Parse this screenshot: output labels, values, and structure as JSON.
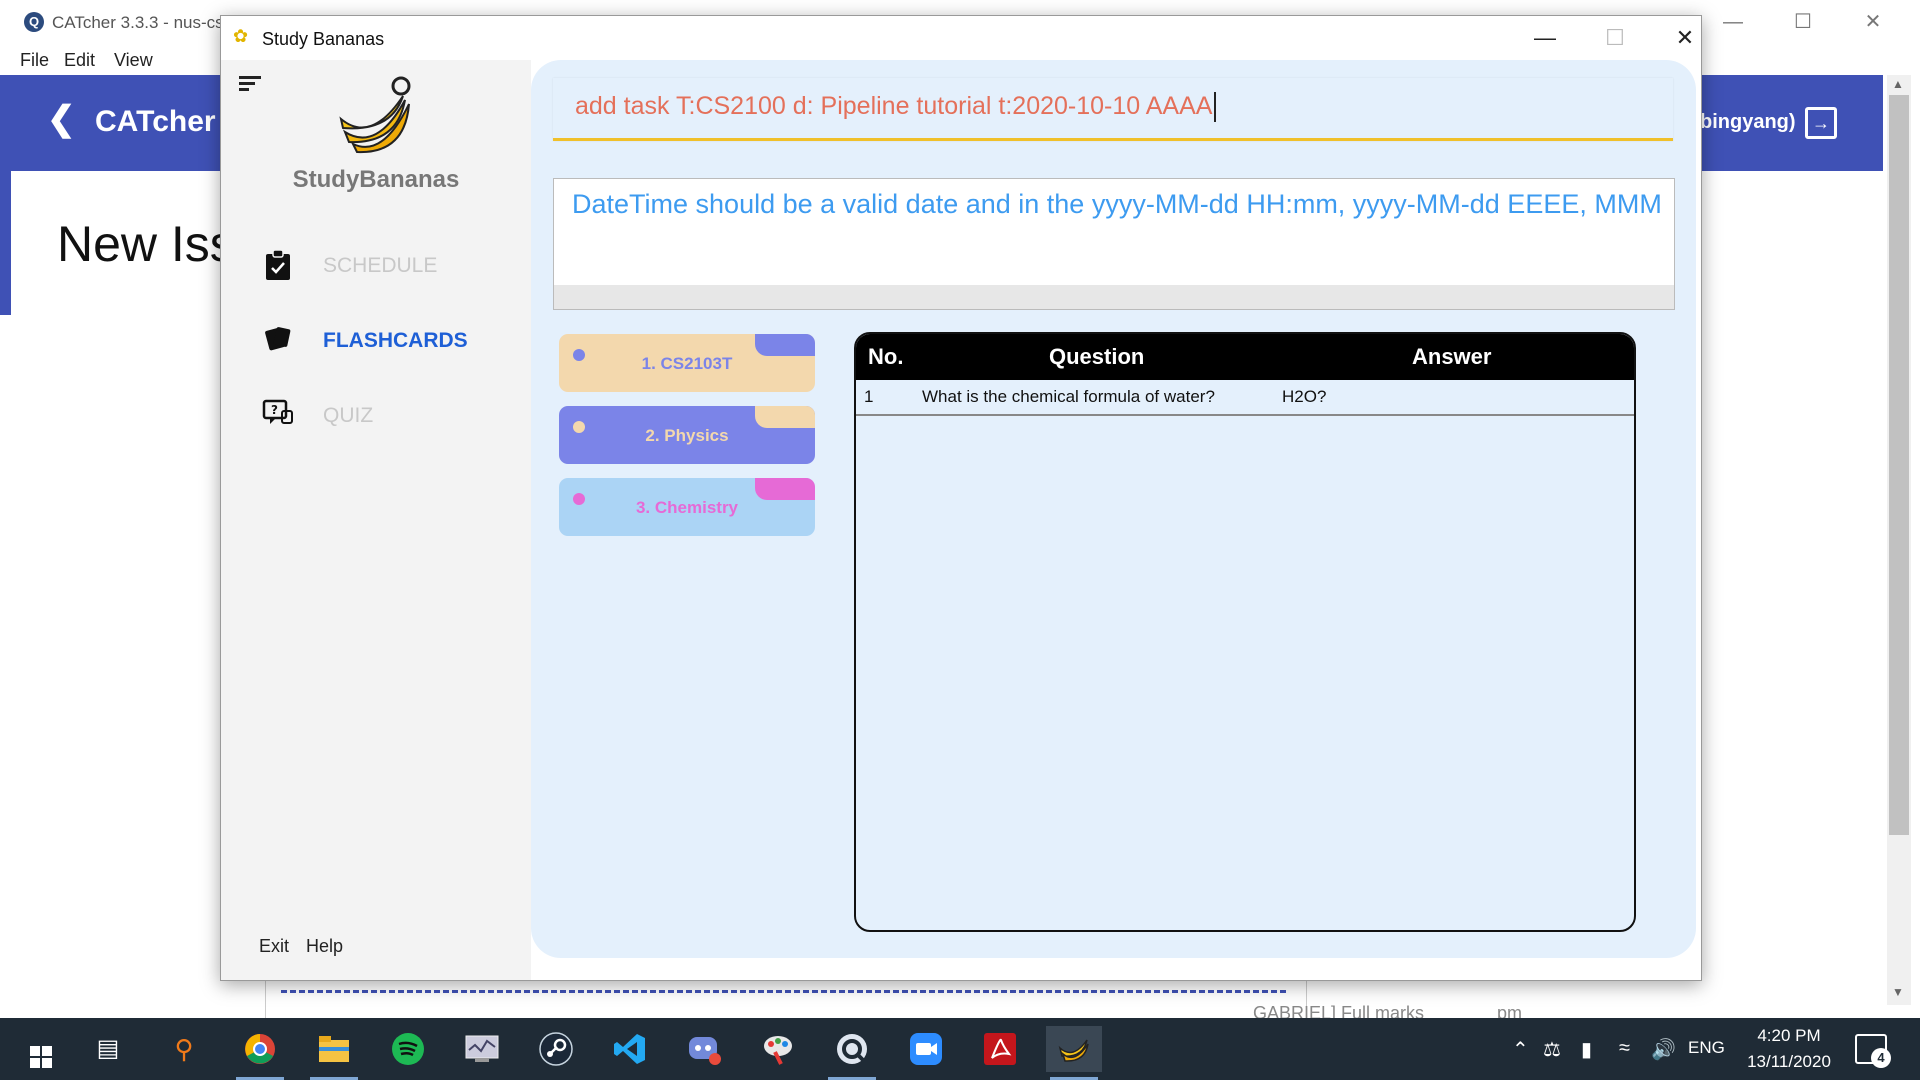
{
  "background_app": {
    "title": "CATcher 3.3.3 - nus-cs",
    "menu": [
      "File",
      "Edit",
      "View"
    ],
    "toolbar_title": "CATcher",
    "user": "bingyang)",
    "heading": "New Iss",
    "bottom_texts": [
      "GABRIEL] Full marks",
      "pm"
    ],
    "brand_color": "#3f51b5"
  },
  "window": {
    "title": "Study Bananas"
  },
  "sidebar": {
    "brand": "StudyBananas",
    "nav": [
      {
        "label": "SCHEDULE",
        "icon": "clipboard-check-icon",
        "active": false
      },
      {
        "label": "FLASHCARDS",
        "icon": "cards-icon",
        "active": true
      },
      {
        "label": "QUIZ",
        "icon": "quiz-icon",
        "active": false
      }
    ],
    "footer": {
      "exit": "Exit",
      "help": "Help"
    }
  },
  "command_box": {
    "value": "add task T:CS2100 d: Pipeline tutorial t:2020-10-10 AAAA"
  },
  "result_display": {
    "text": "DateTime should be a valid date and in the yyyy-MM-dd HH:mm, yyyy-MM-dd EEEE, MMM"
  },
  "decks": [
    {
      "label": "1. CS2103T",
      "bg": "#f3d8ad",
      "accent": "#7b84e8",
      "text_color": "#7b84e8"
    },
    {
      "label": "2. Physics",
      "bg": "#7b84e8",
      "accent": "#f3d8ad",
      "text_color": "#f3d8ad"
    },
    {
      "label": "3. Chemistry",
      "bg": "#abd4f5",
      "accent": "#e66ad6",
      "text_color": "#e66ad6"
    }
  ],
  "flashcard_table": {
    "columns": [
      "No.",
      "Question",
      "Answer"
    ],
    "rows": [
      {
        "no": "1",
        "question": "What is the chemical formula of water?",
        "answer": "H2O?"
      }
    ]
  },
  "taskbar": {
    "apps": [
      "start-icon",
      "task-view-icon",
      "search-icon",
      "chrome-icon",
      "file-explorer-icon",
      "spotify-icon",
      "system-monitor-icon",
      "steam-icon",
      "vscode-icon",
      "discord-icon",
      "paint-icon",
      "catcher-icon",
      "zoom-icon",
      "acrobat-icon",
      "study-bananas-icon"
    ],
    "language": "ENG",
    "time": "4:20 PM",
    "date": "13/11/2020",
    "notification_count": "4"
  }
}
